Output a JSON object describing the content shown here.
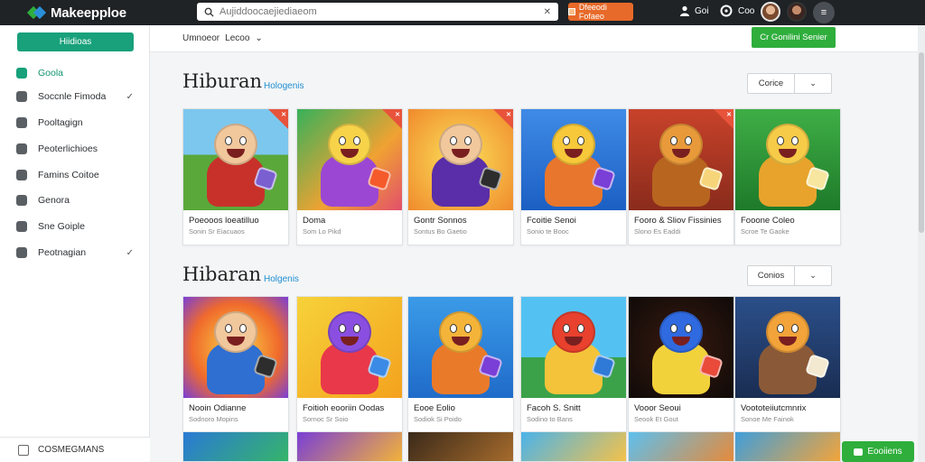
{
  "app": {
    "name": "Makeepploe"
  },
  "search": {
    "placeholder": "Aujiddoocaejiediaeom"
  },
  "top_cta": {
    "label": "Dfeeodi Fofaeo"
  },
  "top_right": {
    "user_label": "Goi",
    "clock_label": "Coo"
  },
  "menu_glyph": "≡",
  "sidebar": {
    "primary_button": "Hiidioas",
    "items": [
      {
        "label": "Goola",
        "icon": "home-icon",
        "active": true,
        "chevron": ""
      },
      {
        "label": "Soccnle Fimoda",
        "icon": "gamepad-icon",
        "active": false,
        "chevron": "✓"
      },
      {
        "label": "Pooltagign",
        "icon": "tag-icon",
        "active": false,
        "chevron": ""
      },
      {
        "label": "Peoterlichioes",
        "icon": "document-icon",
        "active": false,
        "chevron": ""
      },
      {
        "label": "Famins Coitoe",
        "icon": "edit-icon",
        "active": false,
        "chevron": ""
      },
      {
        "label": "Genora",
        "icon": "settings-icon",
        "active": false,
        "chevron": ""
      },
      {
        "label": "Sne Goiple",
        "icon": "help-icon",
        "active": false,
        "chevron": ""
      },
      {
        "label": "Peotnagian",
        "icon": "globe-icon",
        "active": false,
        "chevron": "✓"
      }
    ],
    "footer_label": "COSMEGMANS"
  },
  "subbar": {
    "filter_label": "Umnoeor",
    "filter_value": "Lecoo",
    "filter_chevron": "⌄",
    "action_button": "Cr Gonilini Senier"
  },
  "sections": [
    {
      "title": "Hiburan",
      "link": "Hologenis",
      "sort_label": "Corice",
      "sort_chevron": "⌄",
      "cards": [
        {
          "title": "Poeooos loeatilluo",
          "sub": "Sonin Sr Eiacuaos",
          "art": "boy-dice",
          "corner": true
        },
        {
          "title": "Doma",
          "sub": "Som Lo Pikd",
          "art": "game-logo",
          "corner": true
        },
        {
          "title": "Gontr Sonnos",
          "sub": "Sontus Bo Gaetio",
          "art": "boy-face",
          "corner": true
        },
        {
          "title": "Fcoitie Senoi",
          "sub": "Sonio te Booc",
          "art": "yellow-bot",
          "corner": false
        },
        {
          "title": "Fooro & Sliov Fissinies",
          "sub": "Slono Es Eaddi",
          "art": "lion",
          "corner": true
        },
        {
          "title": "Fooone Coleo",
          "sub": "Scroe Te Gaoke",
          "art": "yellow-bear",
          "corner": false
        }
      ]
    },
    {
      "title": "Hibaran",
      "link": "Holgenis",
      "sort_label": "Conios",
      "sort_chevron": "⌄",
      "cards": [
        {
          "title": "Nooin Odianne",
          "sub": "Sodnoro Mopins",
          "art": "boy-cheer",
          "corner": false
        },
        {
          "title": "Foitioh eooriin Oodas",
          "sub": "Sornoc Sr Soio",
          "art": "purple-ball",
          "corner": false
        },
        {
          "title": "Eooe Eolio",
          "sub": "Sodiok Si Poido",
          "art": "orange-monster",
          "corner": false
        },
        {
          "title": "Facoh S. Snitt",
          "sub": "Sodino to Bans",
          "art": "red-bird",
          "corner": false
        },
        {
          "title": "Vooor Seoui",
          "sub": "Seook Et Gout",
          "art": "star-ball",
          "corner": false
        },
        {
          "title": "Voototeiiutcmnrix",
          "sub": "Sonoe Me Fainok",
          "art": "wolf-logo",
          "corner": false
        }
      ]
    }
  ],
  "chat_button": "Eooiiens",
  "colors": {
    "accent": "#18a17b",
    "topbar": "#1f2326",
    "cta": "#e76a2a",
    "green": "#2fae3c",
    "link": "#1f8fd2"
  }
}
